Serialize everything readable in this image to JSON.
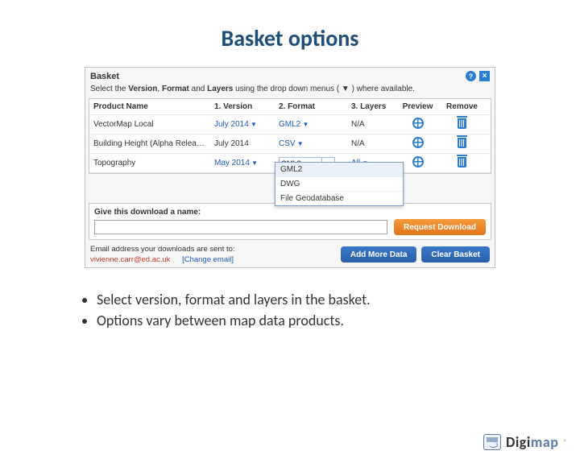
{
  "title": "Basket options",
  "basket": {
    "header": "Basket",
    "instruction_pre": "Select the ",
    "instruction_b1": "Version",
    "instruction_mid1": ", ",
    "instruction_b2": "Format",
    "instruction_mid2": " and ",
    "instruction_b3": "Layers",
    "instruction_post": " using the drop down menus ( ▼ ) where available.",
    "columns": {
      "product": "Product Name",
      "version": "1. Version",
      "format": "2. Format",
      "layers": "3. Layers",
      "preview": "Preview",
      "remove": "Remove"
    },
    "rows": [
      {
        "product": "VectorMap Local",
        "version": "July 2014",
        "version_link": true,
        "format": "GML2",
        "format_link": true,
        "layers": "N/A",
        "layers_link": false
      },
      {
        "product": "Building Height (Alpha Relea…",
        "version": "July 2014",
        "version_link": false,
        "format": "CSV",
        "format_link": true,
        "layers": "N/A",
        "layers_link": false
      },
      {
        "product": "Topography",
        "version": "May 2014",
        "version_link": true,
        "format": "GML2",
        "format_combo": true,
        "layers": "All",
        "layers_link": true
      }
    ],
    "dropdown_options": [
      "GML2",
      "DWG",
      "File Geodatabase"
    ],
    "name_label": "Give this download a name:",
    "name_value": "",
    "request_btn": "Request Download",
    "email_label": "Email address your downloads are sent to:",
    "email_value": "vivienne.carr@ed.ac.uk",
    "change_email": "[Change email]",
    "add_more_btn": "Add More Data",
    "clear_btn": "Clear Basket"
  },
  "bullets": [
    "Select version, format and layers in the basket.",
    "Options vary between map data products."
  ],
  "brand": {
    "part1": "Digi",
    "part2": "map",
    "reg": "®"
  }
}
